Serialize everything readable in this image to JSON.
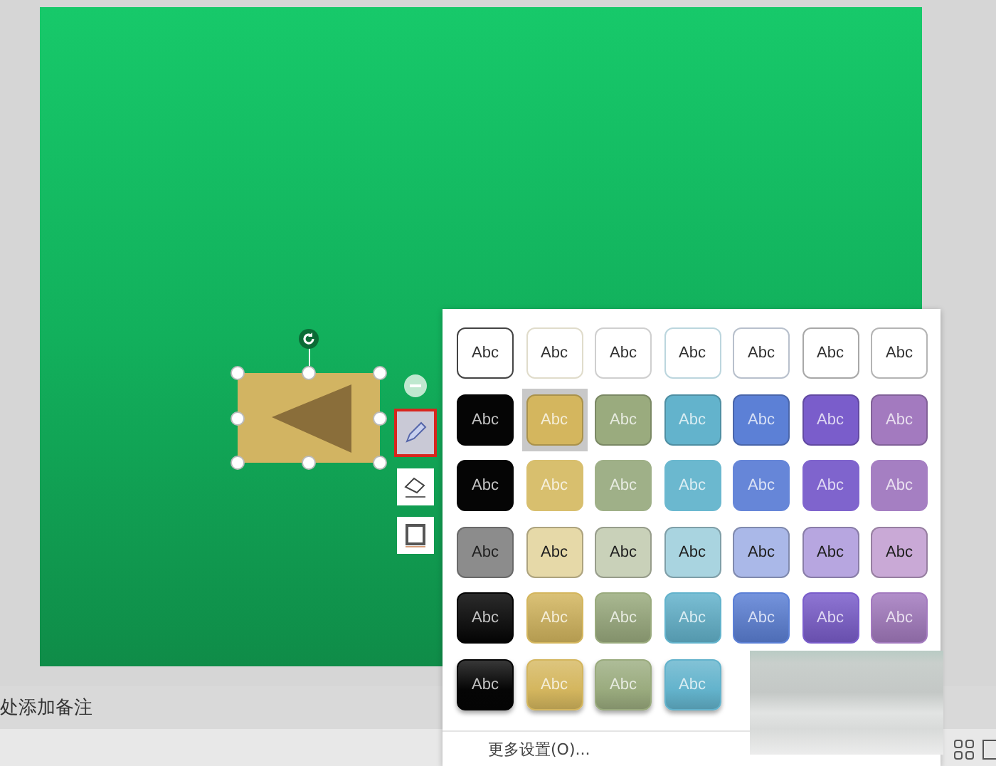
{
  "slide": {
    "shape": {
      "selected": true
    },
    "float_toolbar": [
      {
        "kind": "collapse",
        "selected": false
      },
      {
        "kind": "style",
        "selected": true
      },
      {
        "kind": "fill",
        "selected": false
      },
      {
        "kind": "outline",
        "selected": false
      }
    ]
  },
  "notes": {
    "placeholder": "处添加备注"
  },
  "style_gallery": {
    "rows": [
      {
        "kind": "outline",
        "tiles": [
          {
            "label": "Abc",
            "color": "#444444",
            "selected": false
          },
          {
            "label": "Abc",
            "color": "#e0dccb",
            "selected": false
          },
          {
            "label": "Abc",
            "color": "#cfcfcf",
            "selected": false
          },
          {
            "label": "Abc",
            "color": "#bcd6de",
            "selected": false
          },
          {
            "label": "Abc",
            "color": "#b8c0cc",
            "selected": false
          },
          {
            "label": "Abc",
            "color": "#a8a8a8",
            "selected": false
          },
          {
            "label": "Abc",
            "color": "#b4b4b4",
            "selected": false
          }
        ]
      },
      {
        "kind": "solid",
        "tiles": [
          {
            "label": "Abc",
            "color": "#050505",
            "selected": false
          },
          {
            "label": "Abc",
            "color": "#d4b65e",
            "selected": true
          },
          {
            "label": "Abc",
            "color": "#9aab7e",
            "selected": false
          },
          {
            "label": "Abc",
            "color": "#63b3cc",
            "selected": false
          },
          {
            "label": "Abc",
            "color": "#5c80d6",
            "selected": false
          },
          {
            "label": "Abc",
            "color": "#7a5dcb",
            "selected": false
          },
          {
            "label": "Abc",
            "color": "#a37abf",
            "selected": false
          }
        ]
      },
      {
        "kind": "flat",
        "tiles": [
          {
            "label": "Abc",
            "color": "#050505",
            "selected": false
          },
          {
            "label": "Abc",
            "color": "#d8bf6e",
            "selected": false
          },
          {
            "label": "Abc",
            "color": "#9fb088",
            "selected": false
          },
          {
            "label": "Abc",
            "color": "#6bb8cf",
            "selected": false
          },
          {
            "label": "Abc",
            "color": "#6686d8",
            "selected": false
          },
          {
            "label": "Abc",
            "color": "#7f64cd",
            "selected": false
          },
          {
            "label": "Abc",
            "color": "#a57fc2",
            "selected": false
          }
        ]
      },
      {
        "kind": "pastel",
        "tiles": [
          {
            "label": "Abc",
            "color": "#8c8c8c",
            "selected": false
          },
          {
            "label": "Abc",
            "color": "#e6d9a8",
            "selected": false
          },
          {
            "label": "Abc",
            "color": "#c9d1b9",
            "selected": false
          },
          {
            "label": "Abc",
            "color": "#a9d4e0",
            "selected": false
          },
          {
            "label": "Abc",
            "color": "#aab8e8",
            "selected": false
          },
          {
            "label": "Abc",
            "color": "#b7a6e0",
            "selected": false
          },
          {
            "label": "Abc",
            "color": "#c9a9d6",
            "selected": false
          }
        ]
      },
      {
        "kind": "gradient",
        "tiles": [
          {
            "label": "Abc",
            "color": "#050505",
            "selected": false
          },
          {
            "label": "Abc",
            "color": "#d4b65e",
            "selected": false
          },
          {
            "label": "Abc",
            "color": "#9aab7e",
            "selected": false
          },
          {
            "label": "Abc",
            "color": "#63b3cc",
            "selected": false
          },
          {
            "label": "Abc",
            "color": "#5c80d6",
            "selected": false
          },
          {
            "label": "Abc",
            "color": "#7a5dcb",
            "selected": false
          },
          {
            "label": "Abc",
            "color": "#a37abf",
            "selected": false
          }
        ]
      },
      {
        "kind": "glossy",
        "tiles": [
          {
            "label": "Abc",
            "color": "#050505",
            "selected": false
          },
          {
            "label": "Abc",
            "color": "#d4b65e",
            "selected": false
          },
          {
            "label": "Abc",
            "color": "#9aab7e",
            "selected": false
          },
          {
            "label": "Abc",
            "color": "#63b3cc",
            "selected": false
          }
        ]
      }
    ],
    "more_settings": "更多设置(O)..."
  }
}
